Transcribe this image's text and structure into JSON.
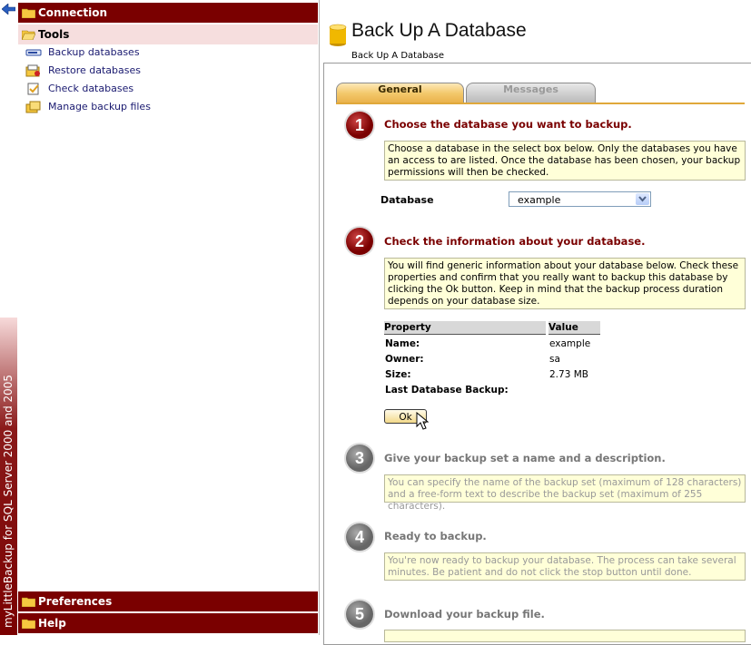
{
  "brand": {
    "vertical_text": "myLittleBackup for SQL Server 2000 and 2005"
  },
  "sidebar": {
    "sections": {
      "connection": "Connection",
      "tools": "Tools",
      "preferences": "Preferences",
      "help": "Help"
    },
    "tools_items": [
      {
        "label": "Backup databases",
        "icon": "backup-icon"
      },
      {
        "label": "Restore databases",
        "icon": "restore-icon"
      },
      {
        "label": "Check databases",
        "icon": "check-icon"
      },
      {
        "label": "Manage backup files",
        "icon": "manage-files-icon"
      }
    ]
  },
  "main": {
    "title": "Back Up A Database",
    "breadcrumb": "Back Up A Database",
    "tabs": {
      "general": "General",
      "messages": "Messages"
    },
    "steps": [
      {
        "number": "1",
        "title": "Choose the database you want to backup.",
        "info": "Choose a database in the select box below. Only the databases you have an access to are listed. Once the database has been chosen, your backup permissions will then be checked."
      },
      {
        "number": "2",
        "title": "Check the information about your database.",
        "info": "You will find generic information about your database below. Check these properties and confirm that you really want to backup this database by clicking the Ok button. Keep in mind that the backup process duration depends on your database size."
      },
      {
        "number": "3",
        "title": "Give your backup set a name and a description.",
        "info": "You can specify the name of the backup set (maximum of 128 characters) and a free-form text to describe the backup set (maximum of 255 characters)."
      },
      {
        "number": "4",
        "title": "Ready to backup.",
        "info": "You're now ready to backup your database. The process can take several minutes. Be patient and do not click the stop button until done."
      },
      {
        "number": "5",
        "title": "Download your backup file.",
        "info": ""
      }
    ],
    "database_field": {
      "label": "Database",
      "value": "example"
    },
    "properties": {
      "headers": {
        "property": "Property",
        "value": "Value"
      },
      "rows": [
        {
          "label": "Name:",
          "value": "example"
        },
        {
          "label": "Owner:",
          "value": "sa"
        },
        {
          "label": "Size:",
          "value": "2.73 MB"
        },
        {
          "label": "Last Database Backup:",
          "value": ""
        }
      ]
    },
    "ok_label": "Ok"
  },
  "colors": {
    "accent": "#7a0000",
    "info_bg": "#ffffd8",
    "tab_active": "#f3c86a"
  }
}
